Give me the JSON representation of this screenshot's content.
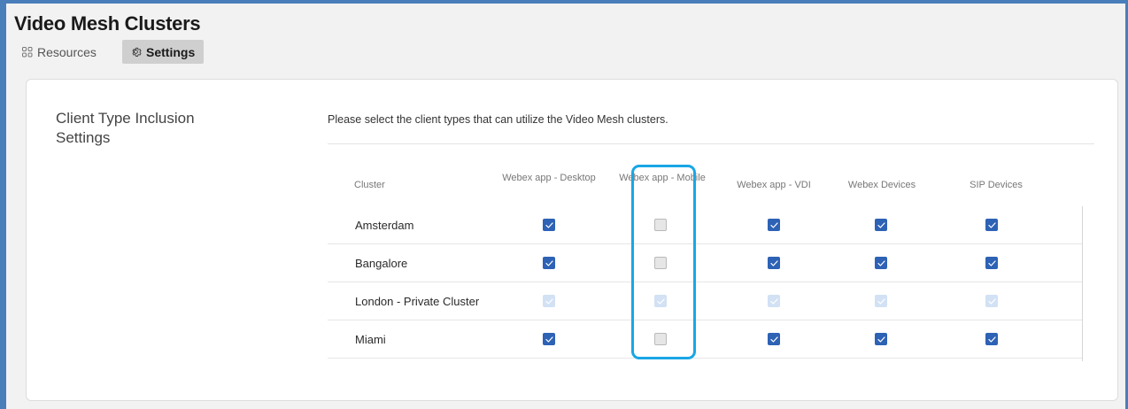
{
  "app_title": "Video Mesh Clusters",
  "tabs": [
    {
      "label": "Resources",
      "icon": "grid-icon",
      "active": false
    },
    {
      "label": "Settings",
      "icon": "gear-icon",
      "active": true
    }
  ],
  "settings": {
    "section_title": "Client Type Inclusion Settings",
    "instruction": "Please select the client types that can utilize the Video Mesh clusters.",
    "columns": [
      "Cluster",
      "Webex app - Desktop",
      "Webex app - Mobile",
      "Webex app - VDI",
      "Webex Devices",
      "SIP Devices"
    ],
    "rows": [
      {
        "cluster": "Amsterdam",
        "desktop": "checked",
        "mobile": "unchecked",
        "vdi": "checked",
        "devices": "checked",
        "sip": "checked"
      },
      {
        "cluster": "Bangalore",
        "desktop": "checked",
        "mobile": "unchecked",
        "vdi": "checked",
        "devices": "checked",
        "sip": "checked"
      },
      {
        "cluster": "London - Private Cluster",
        "desktop": "disabled-checked",
        "mobile": "disabled-checked",
        "vdi": "disabled-checked",
        "devices": "disabled-checked",
        "sip": "disabled-checked"
      },
      {
        "cluster": "Miami",
        "desktop": "checked",
        "mobile": "unchecked",
        "vdi": "checked",
        "devices": "checked",
        "sip": "checked"
      }
    ]
  },
  "colors": {
    "accent": "#2d62b5",
    "highlight": "#1aa6e6",
    "frame": "#4a7ebb"
  }
}
